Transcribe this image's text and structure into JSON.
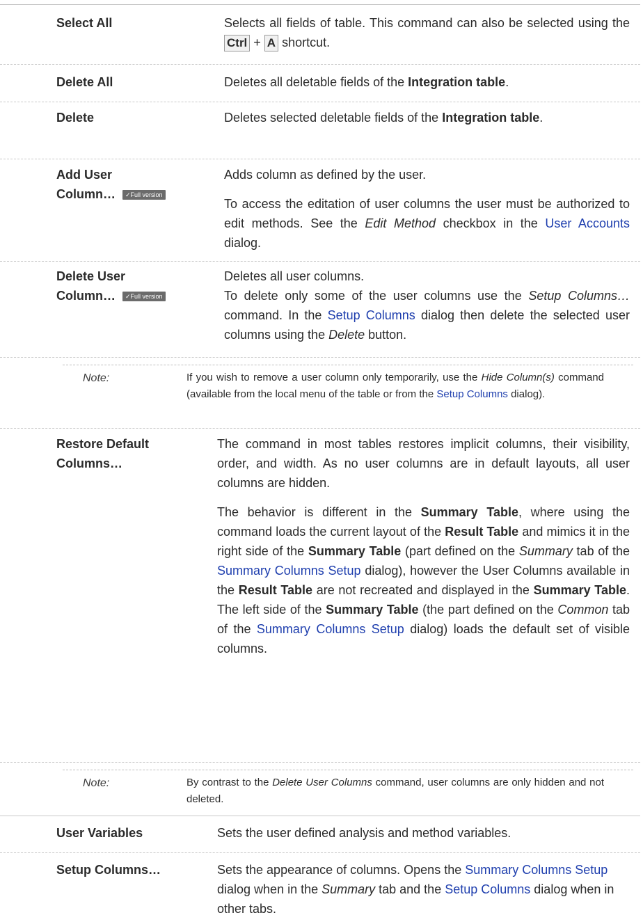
{
  "rows": {
    "select_all": {
      "term": "Select All",
      "desc_a": "Selects all fields of table. This command can also be selected using the ",
      "key1": "Ctrl",
      "plus": " + ",
      "key2": "A",
      "desc_b": " shortcut."
    },
    "delete_all": {
      "term": "Delete All",
      "desc_a": "Deletes all deletable fields of the ",
      "bold": "Integration table",
      "desc_b": "."
    },
    "delete": {
      "term": "Delete",
      "desc_a": "Deletes selected deletable fields of the ",
      "bold": "Integration table",
      "desc_b": "."
    },
    "add_user_column": {
      "term_line1": "Add User",
      "term_line2": "Column…",
      "badge": "✓Full version",
      "p1": "Adds column as defined by the user.",
      "p2_a": "To access the editation of user columns the user must be authorized to edit methods. See the ",
      "p2_i": "Edit Method",
      "p2_b": " checkbox in the ",
      "p2_link": "User Accounts",
      "p2_c": " dialog."
    },
    "delete_user_column": {
      "term_line1": "Delete User",
      "term_line2": "Column…",
      "badge": "✓Full version",
      "p1": "Deletes all user columns.",
      "p2_a": "To delete only some of the user columns use the ",
      "p2_i": "Setup Columns…",
      "p2_b": " command. In the ",
      "p2_link": "Setup Columns",
      "p2_c": " dialog then delete the selected user columns using the ",
      "p2_i2": "Delete",
      "p2_d": " button."
    },
    "restore_default": {
      "term_line1": "Restore Default",
      "term_line2": "Columns…",
      "p1": "The command in most tables restores implicit columns, their visibility, order, and width. As no user columns are in default layouts, all user columns are hidden.",
      "p2_a": "The behavior is different in the ",
      "p2_b1": "Summary Table",
      "p2_b": ", where using the command loads the current layout of the ",
      "p2_b2": "Result Table",
      "p2_c": " and mimics it in the right side of the ",
      "p2_b3": "Summary Table",
      "p2_d": " (part defined on the ",
      "p2_i1": "Summary",
      "p2_e": " tab of the ",
      "p2_link1": "Summary Columns Setup",
      "p2_f": " dialog), however the User Columns available in the ",
      "p2_b4": "Result Table",
      "p2_g": " are not recreated and displayed in the ",
      "p2_b5": "Summary Table",
      "p2_h": ". The left side of the ",
      "p2_b6": "Summary Table",
      "p2_j": " (the part defined on the ",
      "p2_i2": "Common",
      "p2_k": " tab of the ",
      "p2_link2": "Summary Columns Setup",
      "p2_l": " dialog) loads the default set of visible columns."
    },
    "user_variables": {
      "term": "User Variables",
      "desc": "Sets the user defined analysis and method variables."
    },
    "setup_columns": {
      "term": "Setup Columns…",
      "desc_a": "Sets the appearance of columns. Opens the ",
      "link1": "Summary Columns Setup",
      "desc_b": " dialog when in the ",
      "i1": "Summary",
      "desc_c": " tab and the ",
      "link2": "Setup Columns",
      "desc_d": " dialog when in other tabs."
    }
  },
  "notes": {
    "note1": {
      "label": "Note:",
      "a": "If you wish to remove a user column only temporarily, use the ",
      "i": "Hide Column(s)",
      "b": " command (available from the local menu of the table or from the ",
      "link": "Setup Columns",
      "c": " dialog)."
    },
    "note2": {
      "label": "Note:",
      "a": "By contrast to the ",
      "i": "Delete User Columns",
      "b": " command, user columns are only hidden and not deleted."
    }
  }
}
